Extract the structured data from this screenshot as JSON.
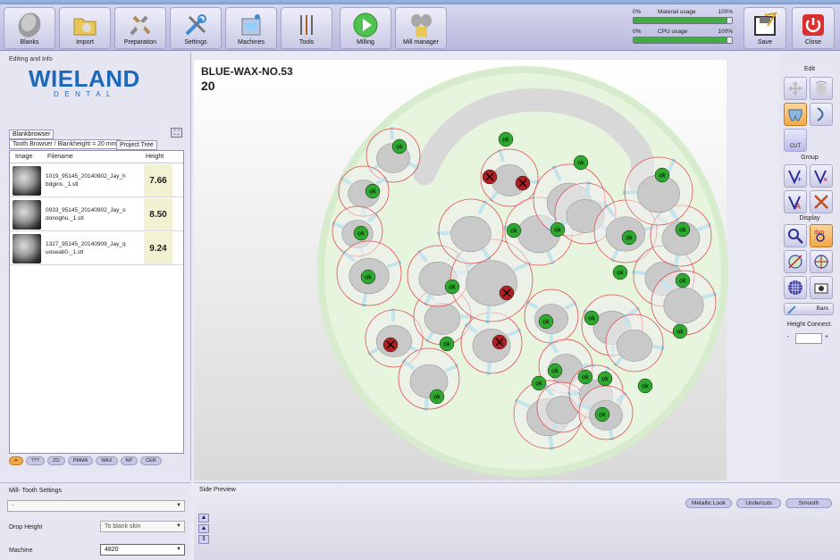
{
  "toolbar": {
    "buttons": [
      {
        "label": "Blanks",
        "icon": "blanks-icon"
      },
      {
        "label": "Import",
        "icon": "import-folder-icon"
      },
      {
        "label": "Preparation",
        "icon": "preparation-tools-icon"
      },
      {
        "label": "Settings",
        "icon": "settings-wrench-icon"
      },
      {
        "label": "Machines",
        "icon": "machines-icon"
      },
      {
        "label": "Tools",
        "icon": "tools-icon"
      },
      {
        "label": "Milling",
        "icon": "milling-play-icon"
      },
      {
        "label": "Mill manager",
        "icon": "mill-manager-icon"
      },
      {
        "label": "Save",
        "icon": "save-icon"
      },
      {
        "label": "Close",
        "icon": "power-close-icon"
      }
    ],
    "material_usage": {
      "label": "Material usage",
      "min": "0%",
      "max": "100%",
      "level": 0.95
    },
    "cpu_usage": {
      "label": "CPU usage",
      "min": "0%",
      "max": "100%",
      "level": 0.95
    }
  },
  "left": {
    "section_title": "Editing and Info",
    "logo": {
      "brand": "WIELAND",
      "sub": "DENTAL"
    },
    "tabs": {
      "blankbrowser": "Blankbrowser",
      "tooth_browser": "Tooth Browser / Blankheight = 20 mm",
      "project_tree": "Project Tree"
    },
    "columns": [
      "Image",
      "Filename",
      "Height"
    ],
    "rows": [
      {
        "filename": "1019_95145_20140902_Jay_h bdgins._1.stl",
        "height": "7.66"
      },
      {
        "filename": "0933_95145_20140902_Jay_o donoghu._1.stl",
        "height": "8.50"
      },
      {
        "filename": "1327_95145_20140909_Jay_q uoseab0._1.stl",
        "height": "9.24"
      }
    ],
    "filters": [
      "",
      "???",
      "ZO",
      "PMMA",
      "WAX",
      "NP",
      "CER"
    ]
  },
  "main": {
    "blank_name": "BLUE-WAX-NO.53",
    "blank_height": "20",
    "ok_label": "ok",
    "status_colors": {
      "ok": "#2ea82e",
      "fail": "#b02020"
    }
  },
  "toolbox": {
    "edit_title": "Edit",
    "cut_label": "CUT",
    "group_title": "Group",
    "display_title": "Display",
    "bars_label": "Bars",
    "height_connect_title": "Height Connect.",
    "minus": "-",
    "plus": "+"
  },
  "bottom": {
    "mill_settings_title": "Mill- Tooth Settings",
    "top_select": "-",
    "drop_height_label": "Drop Height",
    "drop_height_value": "To blank skin",
    "machine_label": "Machine",
    "machine_value": "4820",
    "side_preview_title": "Side Preview",
    "metallic_look": "Metallic Look",
    "undercuts": "Undercuts",
    "smooth": "Smooth"
  }
}
